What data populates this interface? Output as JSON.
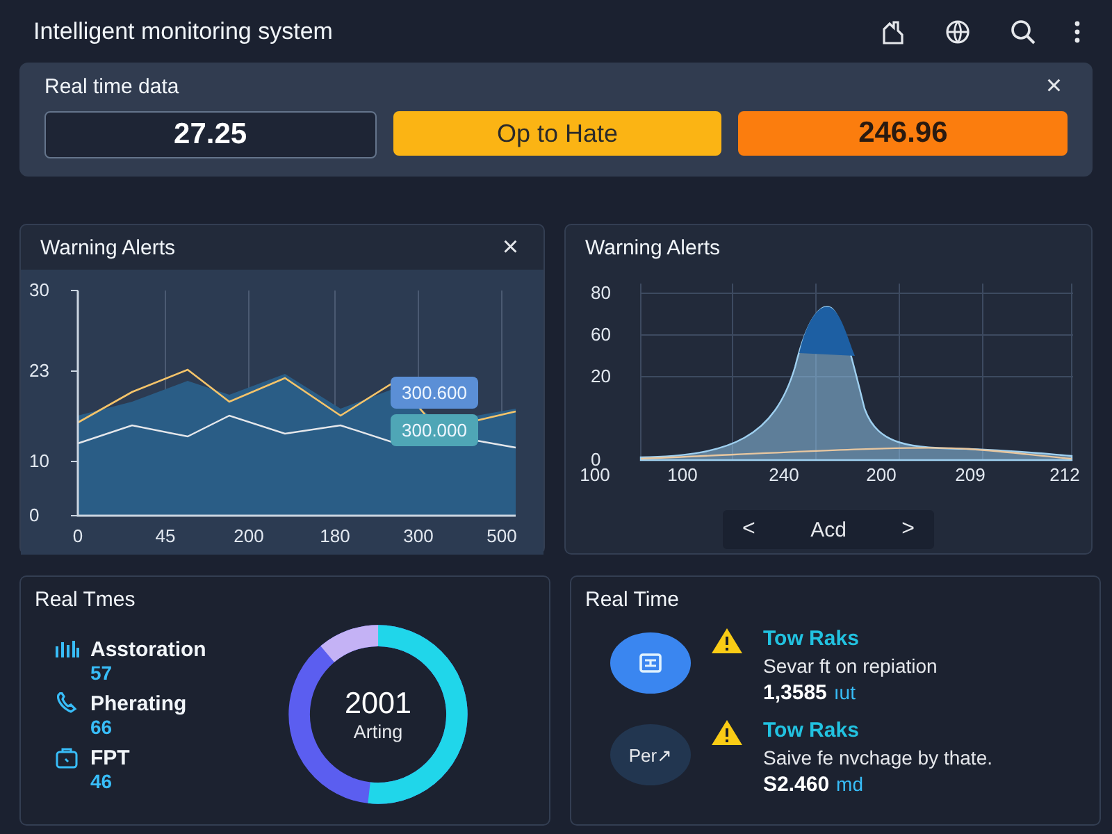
{
  "window": {
    "title": "Intelligent monitoring system"
  },
  "realtime": {
    "title": "Real time data",
    "close": "×",
    "values": [
      {
        "kind": "plain",
        "text": "27.25"
      },
      {
        "kind": "warning",
        "text": "Op to Hate"
      },
      {
        "kind": "alert",
        "text": "246.96"
      }
    ]
  },
  "chart_left": {
    "title": "Warning Alerts",
    "close": "×",
    "yticks": [
      "30",
      "23",
      "10",
      "0"
    ],
    "xticks": [
      "0",
      "45",
      "200",
      "180",
      "300",
      "500"
    ],
    "badges": [
      "300.600",
      "300.000"
    ]
  },
  "chart_right": {
    "title": "Warning Alerts",
    "yticks": [
      "80",
      "60",
      "20",
      "0"
    ],
    "xticks": [
      "100",
      "100",
      "240",
      "200",
      "209",
      "212"
    ],
    "pager": {
      "prev": "<",
      "label": "Acd",
      "next": ">"
    }
  },
  "stats": {
    "title": "Real Tmes",
    "items": [
      {
        "kind": "bars",
        "label": "Asstoration",
        "value": "57"
      },
      {
        "kind": "phone",
        "label": "Pherating",
        "value": "66"
      },
      {
        "kind": "bag",
        "label": "FPT",
        "value": "46"
      }
    ],
    "donut": {
      "value": "2001",
      "label": "Arting"
    }
  },
  "alerts": {
    "title": "Real Time",
    "items": [
      {
        "kind": "icon",
        "title": "Tow Raks",
        "text": "Sevar ft on repiation",
        "amount": "1,3585",
        "unit": "ıut"
      },
      {
        "kind": "text",
        "avatar": "Per↗",
        "title": "Tow Raks",
        "text": "Saive fe nvchage by thate.",
        "amount": "S2.460",
        "unit": "md"
      }
    ]
  }
}
